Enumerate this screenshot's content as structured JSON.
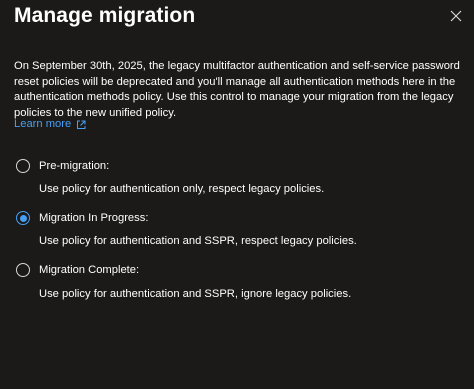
{
  "dialog": {
    "title": "Manage migration",
    "description": "On September 30th, 2025, the legacy multifactor authentication and self-service password reset policies will be deprecated and you'll manage all authentication methods here in the authentication methods policy. Use this control to manage your migration from the legacy policies to the new unified policy.",
    "learn_more": "Learn more",
    "options": [
      {
        "label": "Pre-migration:",
        "description": "Use policy for authentication only, respect legacy policies.",
        "selected": false
      },
      {
        "label": "Migration In Progress:",
        "description": "Use policy for authentication and SSPR, respect legacy policies.",
        "selected": true
      },
      {
        "label": "Migration Complete:",
        "description": "Use policy for authentication and SSPR, ignore legacy policies.",
        "selected": false
      }
    ]
  },
  "icons": {
    "close": "close-icon",
    "external_link": "external-link-icon"
  },
  "colors": {
    "background": "#1b1a19",
    "accent": "#479ef5",
    "text": "#ffffff"
  }
}
